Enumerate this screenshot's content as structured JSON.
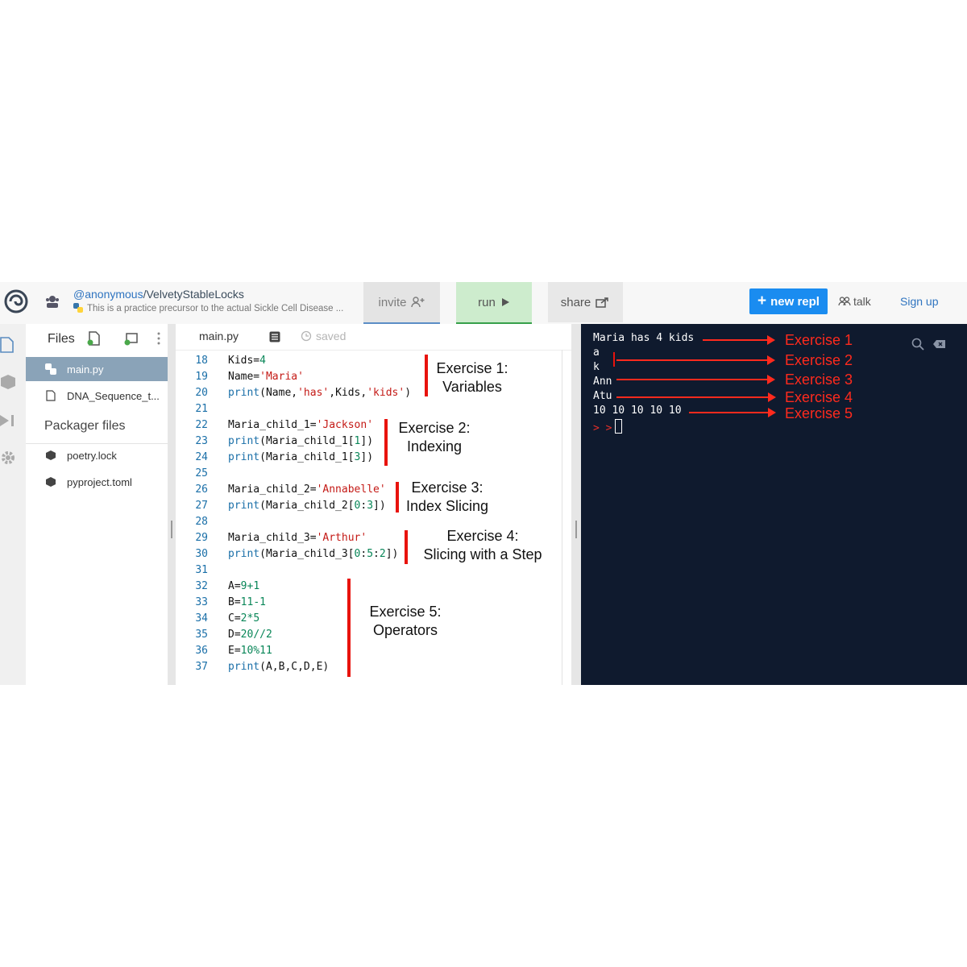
{
  "header": {
    "owner": "@anonymous",
    "repl_name": "/VelvetyStableLocks",
    "description": "This is a practice precursor to the actual Sickle Cell Disease ...",
    "invite_label": "invite",
    "run_label": "run",
    "share_label": "share",
    "new_repl_label": "new repl",
    "talk_label": "talk",
    "signup_label": "Sign up"
  },
  "files_panel": {
    "title": "Files",
    "files": [
      "main.py",
      "DNA_Sequence_t..."
    ],
    "packager_title": "Packager files",
    "packager_files": [
      "poetry.lock",
      "pyproject.toml"
    ]
  },
  "editor": {
    "tab_name": "main.py",
    "saved_label": "saved",
    "line_numbers": [
      "18",
      "19",
      "20",
      "21",
      "22",
      "23",
      "24",
      "25",
      "26",
      "27",
      "28",
      "29",
      "30",
      "31",
      "32",
      "33",
      "34",
      "35",
      "36",
      "37"
    ],
    "code_lines": [
      "Kids=4",
      "Name='Maria'",
      "print(Name,'has',Kids,'kids')",
      "",
      "Maria_child_1='Jackson'",
      "print(Maria_child_1[1])",
      "print(Maria_child_1[3])",
      "",
      "Maria_child_2='Annabelle'",
      "print(Maria_child_2[0:3])",
      "",
      "Maria_child_3='Arthur'",
      "print(Maria_child_3[0:5:2])",
      "",
      "A=9+1",
      "B=11-1",
      "C=2*5",
      "D=20//2",
      "E=10%11",
      "print(A,B,C,D,E)"
    ],
    "annotations": [
      {
        "line1": "Exercise 1:",
        "line2": "Variables"
      },
      {
        "line1": "Exercise 2:",
        "line2": "Indexing"
      },
      {
        "line1": "Exercise 3:",
        "line2": "Index Slicing"
      },
      {
        "line1": "Exercise 4:",
        "line2": "Slicing with a Step"
      },
      {
        "line1": "Exercise 5:",
        "line2": "Operators"
      }
    ]
  },
  "console": {
    "output_lines": [
      "Maria has 4 kids",
      "a",
      "k",
      "Ann",
      "Atu",
      "10 10 10 10 10"
    ],
    "prompt": "> >",
    "exercise_labels": [
      "Exercise 1",
      "Exercise 2",
      "Exercise 3",
      "Exercise 4",
      "Exercise 5"
    ]
  },
  "colors": {
    "accent_blue": "#1a8cf0",
    "run_green": "#37a04a",
    "annotation_red": "#e8130d",
    "console_bg": "#0f1a2e",
    "keyword": "#1a6fa8",
    "string": "#c41a16",
    "number": "#098658"
  }
}
